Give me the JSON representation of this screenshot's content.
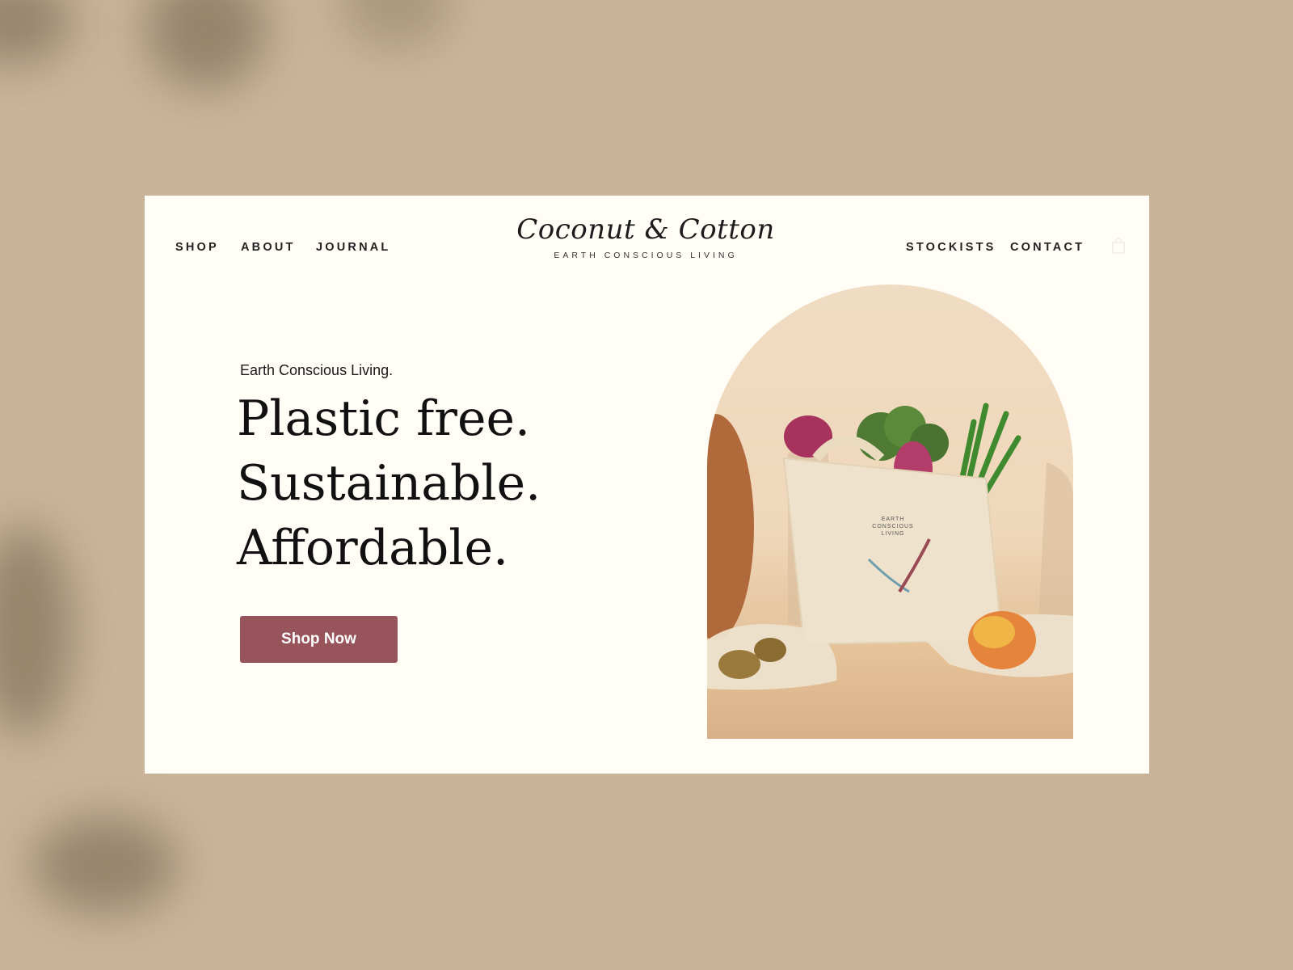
{
  "nav": {
    "left": [
      {
        "label": "SHOP"
      },
      {
        "label": "ABOUT"
      },
      {
        "label": "JOURNAL"
      }
    ],
    "right": [
      {
        "label": "STOCKISTS"
      },
      {
        "label": "CONTACT"
      }
    ],
    "cart_icon": "shopping-bag-icon"
  },
  "logo": {
    "name": "Coconut & Cotton",
    "tagline": "EARTH CONSCIOUS LIVING"
  },
  "hero": {
    "eyebrow": "Earth Conscious Living.",
    "headline": [
      "Plastic free.",
      "Sustainable.",
      "Affordable."
    ],
    "cta_label": "Shop Now",
    "image_alt": "Cotton tote bag with vegetables, mesh produce bags with kiwis and a mango",
    "tote_print": [
      "EARTH",
      "CONSCIOUS",
      "LIVING"
    ]
  },
  "colors": {
    "accent": "#97545a",
    "card_bg": "#fffdf6",
    "page_bg": "#c9b49a",
    "text": "#111111"
  }
}
